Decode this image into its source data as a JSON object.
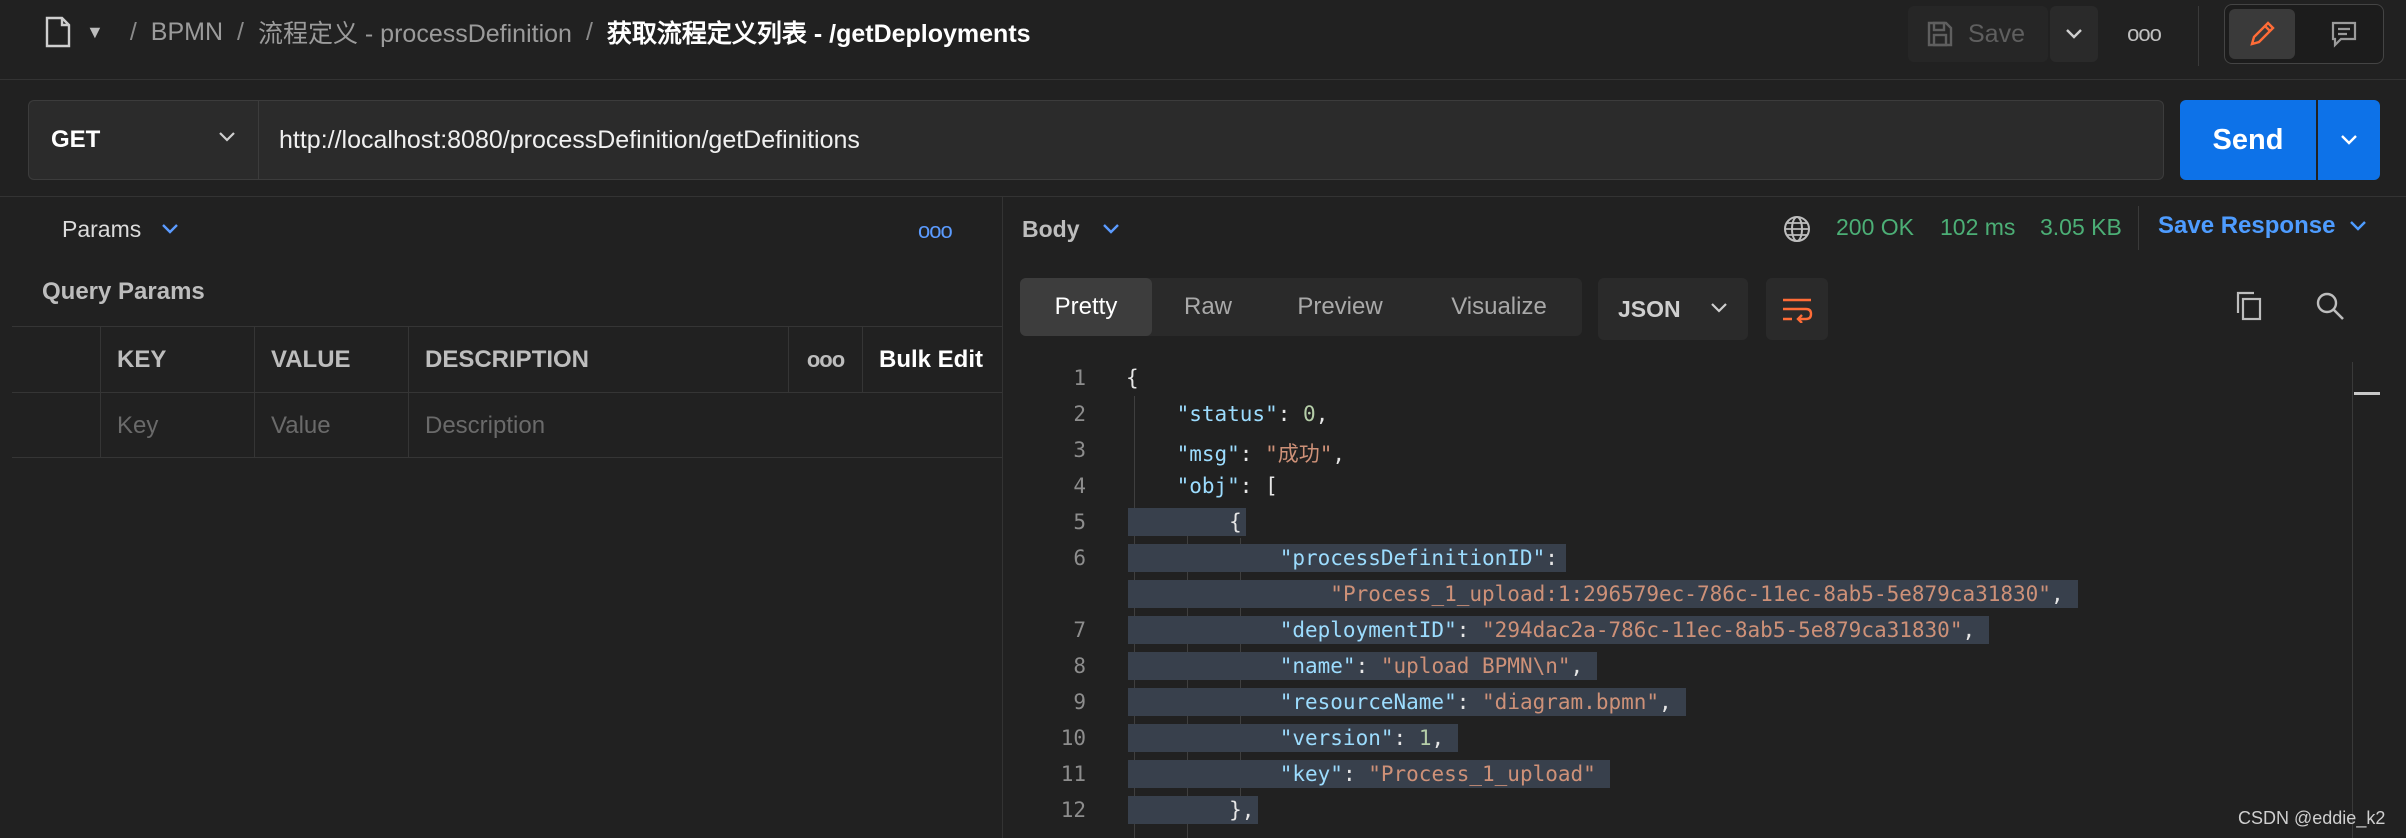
{
  "breadcrumb": {
    "items": [
      "BPMN",
      "流程定义 - processDefinition"
    ],
    "current": "获取流程定义列表 - /getDeployments",
    "separator": "/"
  },
  "toolbar": {
    "save_label": "Save",
    "more_label": "ooo"
  },
  "request": {
    "method": "GET",
    "url": "http://localhost:8080/processDefinition/getDefinitions",
    "send_label": "Send"
  },
  "left_pane": {
    "tab_label": "Params",
    "section_title": "Query Params",
    "more_label": "ooo",
    "table": {
      "headers": {
        "key": "KEY",
        "value": "VALUE",
        "description": "DESCRIPTION",
        "more": "ooo",
        "bulk": "Bulk Edit"
      },
      "placeholders": {
        "key": "Key",
        "value": "Value",
        "description": "Description"
      }
    }
  },
  "response": {
    "tab_label": "Body",
    "status": "200 OK",
    "time": "102 ms",
    "size": "3.05 KB",
    "save_label": "Save Response",
    "views": [
      "Pretty",
      "Raw",
      "Preview",
      "Visualize"
    ],
    "active_view": "Pretty",
    "format": "JSON",
    "colors": {
      "status": "#4caf76",
      "accent": "#0d72e8",
      "link": "#4e9cff"
    }
  },
  "code": {
    "line_numbers": [
      "1",
      "2",
      "3",
      "4",
      "5",
      "6",
      "7",
      "8",
      "9",
      "10",
      "11",
      "12"
    ],
    "l1": "{",
    "l2": {
      "key": "\"status\"",
      "p": ": ",
      "val": "0",
      "end": ","
    },
    "l3": {
      "key": "\"msg\"",
      "p": ": ",
      "val": "\"成功\"",
      "end": ","
    },
    "l4": {
      "key": "\"obj\"",
      "p": ": ["
    },
    "l5": "{",
    "l6": {
      "key": "\"processDefinitionID\"",
      "p": ":"
    },
    "l6b": {
      "val": "\"Process_1_upload:1:296579ec-786c-11ec-8ab5-5e879ca31830\"",
      "end": ","
    },
    "l7": {
      "key": "\"deploymentID\"",
      "p": ": ",
      "val": "\"294dac2a-786c-11ec-8ab5-5e879ca31830\"",
      "end": ","
    },
    "l8": {
      "key": "\"name\"",
      "p": ": ",
      "val": "\"upload BPMN\\n\"",
      "end": ","
    },
    "l9": {
      "key": "\"resourceName\"",
      "p": ": ",
      "val": "\"diagram.bpmn\"",
      "end": ","
    },
    "l10": {
      "key": "\"version\"",
      "p": ": ",
      "val": "1",
      "end": ","
    },
    "l11": {
      "key": "\"key\"",
      "p": ": ",
      "val": "\"Process_1_upload\""
    },
    "l12": "},"
  },
  "watermark": "CSDN @eddie_k2"
}
